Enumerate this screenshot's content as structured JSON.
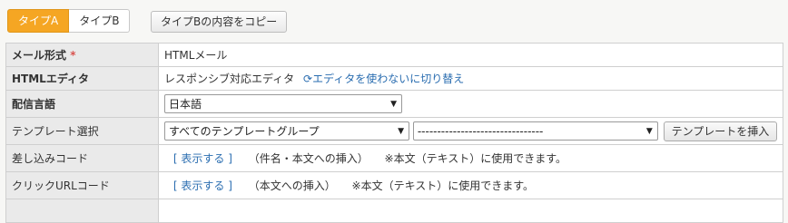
{
  "tabs": [
    {
      "label": "タイプA",
      "active": true
    },
    {
      "label": "タイプB",
      "active": false
    }
  ],
  "copy_button": "タイプBの内容をコピー",
  "rows": {
    "mail_format": {
      "label": "メール形式",
      "required_mark": "*",
      "value": "HTMLメール"
    },
    "html_editor": {
      "label": "HTMLエディタ",
      "value": "レスポンシブ対応エディタ",
      "switch_link": "エディタを使わないに切り替え"
    },
    "language": {
      "label": "配信言語",
      "selected": "日本語"
    },
    "template": {
      "label": "テンプレート選択",
      "group_selected": "すべてのテンプレートグループ",
      "template_selected": "--------------------------------",
      "insert_button": "テンプレートを挿入"
    },
    "insert_code": {
      "label": "差し込みコード",
      "bracket_open": "[",
      "show_link": "表示する",
      "bracket_close": "]",
      "desc": "（件名・本文への挿入）",
      "note": "※本文（テキスト）に使用できます。"
    },
    "click_url": {
      "label": "クリックURLコード",
      "bracket_open": "[",
      "show_link": "表示する",
      "bracket_close": "]",
      "desc": "（本文への挿入）",
      "note": "※本文（テキスト）に使用できます。"
    }
  },
  "colors": {
    "accent": "#f5a623",
    "link": "#2a6db0",
    "required": "#d9534f"
  }
}
